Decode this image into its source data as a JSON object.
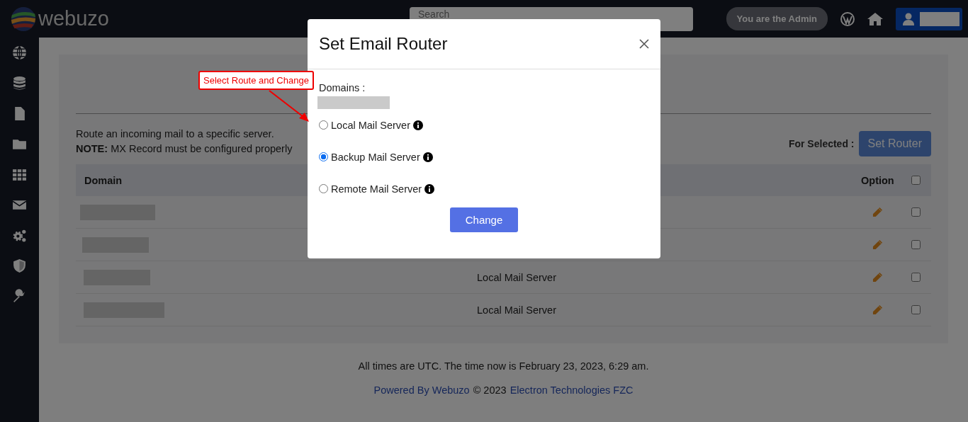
{
  "header": {
    "logo_text": "webuzo",
    "search": {
      "placeholder": "Search"
    },
    "admin_badge": "You are the Admin"
  },
  "page": {
    "description": "Route an incoming mail to a specific server.",
    "note": "**NOTE:** MX Record must be configured properly",
    "for_selected_label": "For Selected :",
    "set_router_button": "Set Router"
  },
  "table": {
    "columns": [
      "Domain",
      "Option"
    ],
    "select_all": {
      "checked": false
    },
    "rows": [
      {
        "checked": false
      },
      {
        "checked": false
      },
      {
        "route": "Local Mail Server",
        "checked": false
      },
      {
        "route": "Local Mail Server",
        "checked": false
      }
    ]
  },
  "footer": {
    "time_note": "All times are UTC. The time now is February 23, 2023, 6:29 am.",
    "powered_by": "Powered By Webuzo",
    "copyright": "© 2023",
    "company": "Electron Technologies FZC"
  },
  "modal": {
    "title": "Set Email Router",
    "domains_label": "Domains :",
    "options": [
      {
        "label": "Local Mail Server",
        "selected": false
      },
      {
        "label": "Backup Mail Server",
        "selected": true
      },
      {
        "label": "Remote Mail Server",
        "selected": false
      }
    ],
    "button": "Change"
  },
  "annotation": {
    "text": "Select Route and Change"
  }
}
